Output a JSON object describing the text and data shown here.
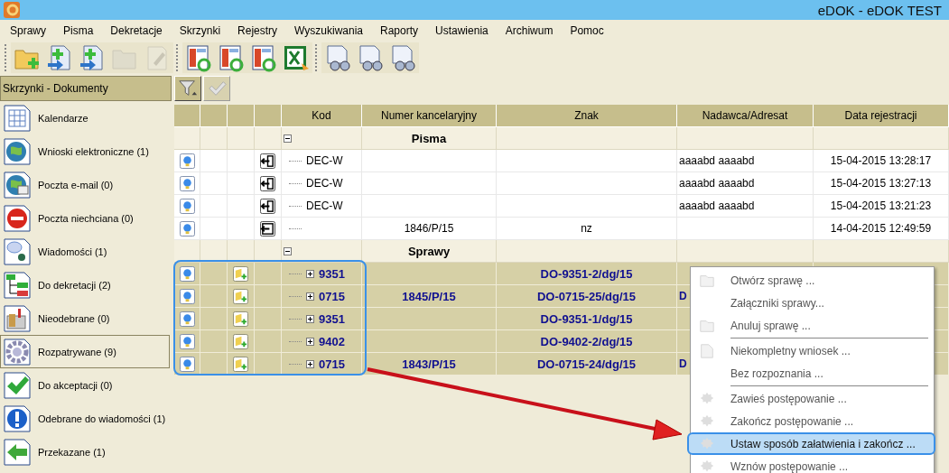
{
  "window": {
    "title": "eDOK - eDOK TEST"
  },
  "menu": [
    "Sprawy",
    "Pisma",
    "Dekretacje",
    "Skrzynki",
    "Rejestry",
    "Wyszukiwania",
    "Raporty",
    "Ustawienia",
    "Archiwum",
    "Pomoc"
  ],
  "toolbar": [
    [
      {
        "disabled": false
      },
      {
        "disabled": false
      },
      {
        "disabled": false
      },
      {
        "disabled": true
      },
      {
        "disabled": true
      }
    ],
    [
      {
        "disabled": false
      },
      {
        "disabled": false
      },
      {
        "disabled": false
      },
      {
        "disabled": false
      }
    ],
    [
      {
        "disabled": false
      },
      {
        "disabled": false
      },
      {
        "disabled": false
      }
    ]
  ],
  "sidebar": {
    "header": "Skrzynki - Dokumenty",
    "items": [
      {
        "label": "Kalendarze",
        "selected": false
      },
      {
        "label": "Wnioski elektroniczne (1)",
        "selected": false
      },
      {
        "label": "Poczta e-mail (0)",
        "selected": false
      },
      {
        "label": "Poczta niechciana (0)",
        "selected": false
      },
      {
        "label": "Wiadomości (1)",
        "selected": false
      },
      {
        "label": "Do dekretacji (2)",
        "selected": false
      },
      {
        "label": "Nieodebrane (0)",
        "selected": false
      },
      {
        "label": "Rozpatrywane (9)",
        "selected": true
      },
      {
        "label": "Do akceptacji (0)",
        "selected": false
      },
      {
        "label": "Odebrane do wiadomości (1)",
        "selected": false
      },
      {
        "label": "Przekazane (1)",
        "selected": false
      }
    ]
  },
  "filter_bar": [
    {
      "disabled": false
    },
    {
      "disabled": true
    }
  ],
  "table": {
    "columns": [
      "Kod",
      "Numer kancelaryjny",
      "Znak",
      "Nadawca/Adresat",
      "Data rejestracji"
    ],
    "groups": [
      {
        "title": "Pisma",
        "expanded": true,
        "rows": [
          {
            "kind": "letter-out",
            "kod": "DEC-W",
            "numer": "",
            "znak": "",
            "nadawca": "aaaabd aaaabd",
            "data": "15-04-2015 13:28:17",
            "selected": false
          },
          {
            "kind": "letter-out",
            "kod": "DEC-W",
            "numer": "",
            "znak": "",
            "nadawca": "aaaabd aaaabd",
            "data": "15-04-2015 13:27:13",
            "selected": false
          },
          {
            "kind": "letter-out",
            "kod": "DEC-W",
            "numer": "",
            "znak": "",
            "nadawca": "aaaabd aaaabd",
            "data": "15-04-2015 13:21:23",
            "selected": false
          },
          {
            "kind": "letter-in",
            "kod": "",
            "numer": "1846/P/15",
            "znak": "nz",
            "nadawca": "",
            "data": "14-04-2015 12:49:59",
            "selected": false
          }
        ]
      },
      {
        "title": "Sprawy",
        "expanded": true,
        "rows": [
          {
            "kind": "case",
            "kod": "9351",
            "expanded": false,
            "numer": "",
            "znak": "DO-9351-2/dg/15",
            "nadawca": "",
            "data": "",
            "selected": true
          },
          {
            "kind": "case",
            "kod": "0715",
            "expanded": false,
            "numer": "1845/P/15",
            "znak": "DO-0715-25/dg/15",
            "nadawca": "D",
            "data": "",
            "selected": true
          },
          {
            "kind": "case",
            "kod": "9351",
            "expanded": false,
            "numer": "",
            "znak": "DO-9351-1/dg/15",
            "nadawca": "",
            "data": "",
            "selected": true
          },
          {
            "kind": "case",
            "kod": "9402",
            "expanded": false,
            "numer": "",
            "znak": "DO-9402-2/dg/15",
            "nadawca": "",
            "data": "",
            "selected": true
          },
          {
            "kind": "case",
            "kod": "0715",
            "expanded": false,
            "numer": "1843/P/15",
            "znak": "DO-0715-24/dg/15",
            "nadawca": "D",
            "data": "",
            "selected": true
          }
        ]
      }
    ]
  },
  "context_menu": [
    {
      "kind": "item",
      "label": "Otwórz sprawę ...",
      "highlighted": false
    },
    {
      "kind": "item",
      "label": "Załączniki sprawy...",
      "highlighted": false
    },
    {
      "kind": "item",
      "label": "Anuluj sprawę ...",
      "highlighted": false
    },
    {
      "kind": "separator"
    },
    {
      "kind": "item",
      "label": "Niekompletny wniosek ...",
      "highlighted": false
    },
    {
      "kind": "item",
      "label": "Bez rozpoznania ...",
      "highlighted": false
    },
    {
      "kind": "separator"
    },
    {
      "kind": "item",
      "label": "Zawieś postępowanie ...",
      "highlighted": false
    },
    {
      "kind": "item",
      "label": "Zakończ postępowanie ...",
      "highlighted": false
    },
    {
      "kind": "item",
      "label": "Ustaw sposób załatwienia i zakończ ...",
      "highlighted": true
    },
    {
      "kind": "item",
      "label": "Wznów postępowanie ...",
      "highlighted": false
    }
  ]
}
